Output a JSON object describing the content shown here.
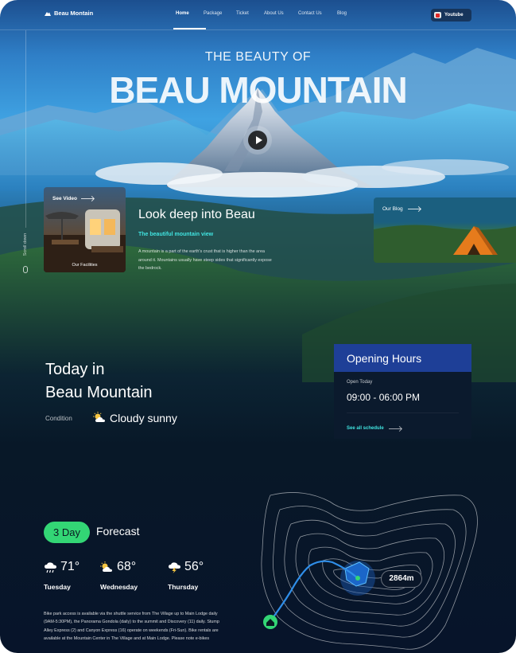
{
  "header": {
    "brand": "Beau Montain",
    "nav": [
      {
        "label": "Home",
        "active": true
      },
      {
        "label": "Package",
        "active": false
      },
      {
        "label": "Ticket",
        "active": false
      },
      {
        "label": "About Us",
        "active": false
      },
      {
        "label": "Contact Us",
        "active": false
      },
      {
        "label": "Blog",
        "active": false
      }
    ],
    "youtube_label": "Youtube"
  },
  "hero": {
    "kicker": "THE BEAUTY OF",
    "headline": "BEAU MOUNTAIN",
    "play_icon": "play-icon",
    "scroll_label": "Scroll down"
  },
  "video_card": {
    "cta": "See Video",
    "caption": "Our Facilities"
  },
  "intro": {
    "title": "Look deep into Beau",
    "subtitle": "The beautiful mountain view",
    "body": "A mountain is a part of the earth's crust that is higher than the area around it. Mountains usually have steep sides that significantly expose the bedrock."
  },
  "blog_card": {
    "label": "Our Blog"
  },
  "today": {
    "title_line1": "Today in",
    "title_line2": "Beau Mountain",
    "condition_label": "Condition",
    "condition_value": "Cloudy sunny",
    "condition_icon": "partly-cloudy-icon"
  },
  "hours": {
    "title": "Opening Hours",
    "open_label": "Open Today",
    "time": "09:00 - 06:00 PM",
    "link": "See all schedule"
  },
  "forecast": {
    "pill": "3 Day",
    "word": "Forecast",
    "days": [
      {
        "temp": "71°",
        "name": "Tuesday",
        "icon": "rain-cloud-icon"
      },
      {
        "temp": "68°",
        "name": "Wednesday",
        "icon": "partly-cloudy-icon"
      },
      {
        "temp": "56°",
        "name": "Thursday",
        "icon": "thunder-cloud-icon"
      }
    ],
    "note": "Bike park access is available via the shuttle service from The Village up to Main Lodge daily (9AM-5:30PM), the Panorama Gondola (daily) to the summit and Discovery (11) daily. Stump Alley Express (2) and Canyon Express (16) operate on weekends (Fri-Sun). Bike rentals are available at the Mountain Center in The Village and at Main Lodge. Please note e-bikes"
  },
  "map": {
    "altitude": "2864m",
    "home_icon": "home-pin-icon"
  },
  "colors": {
    "accent_cyan": "#41e4e0",
    "accent_green": "#33d675",
    "hours_header": "#1e3f97",
    "route_blue": "#2f8ee8"
  }
}
